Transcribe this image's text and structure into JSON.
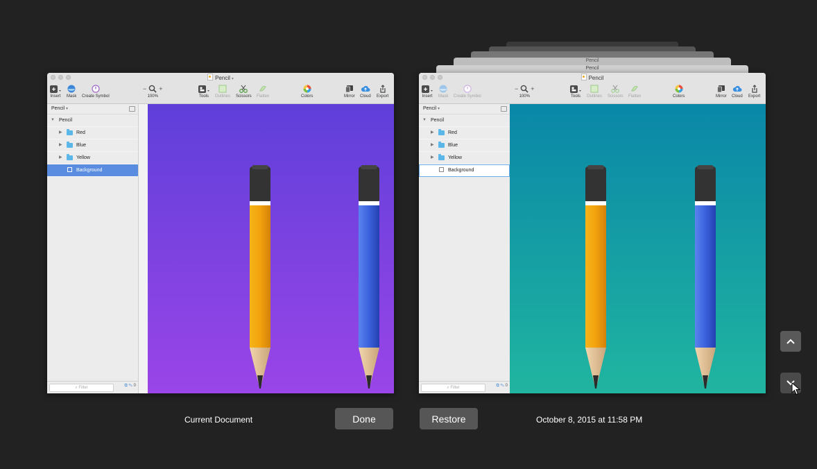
{
  "app_title": "Pencil",
  "toolbar": {
    "insert": "Insert",
    "mask": "Mask",
    "create_symbol": "Create Symbol",
    "zoom_minus": "−",
    "zoom_plus": "+",
    "zoom_level": "100%",
    "tools": "Tools",
    "outlines": "Outlines",
    "scissors": "Scissors",
    "flatten": "Flatten",
    "colors": "Colors",
    "mirror": "Mirror",
    "cloud": "Cloud",
    "export": "Export"
  },
  "sidebar": {
    "page": "Pencil",
    "layers": [
      {
        "name": "Pencil"
      },
      {
        "name": "Red"
      },
      {
        "name": "Blue"
      },
      {
        "name": "Yellow"
      },
      {
        "name": "Background"
      }
    ],
    "filter_placeholder": "Filter",
    "edited_count": "0"
  },
  "left_window": {
    "gradient_top": "#5f3fd9",
    "gradient_bottom": "#9a45e8"
  },
  "right_window": {
    "stacked_titles": [
      "Pencil",
      "Pencil",
      "Pencil"
    ],
    "gradient_top": "#0a87a8",
    "gradient_bottom": "#20b5a0"
  },
  "footer": {
    "current_label": "Current Document",
    "done_label": "Done",
    "restore_label": "Restore",
    "version_date": "October 8, 2015 at 11:58 PM"
  },
  "colors": {
    "background": "#222222",
    "button": "#565656",
    "pencil_yellow": "#f3a20e",
    "pencil_blue": "#3b62dd"
  }
}
